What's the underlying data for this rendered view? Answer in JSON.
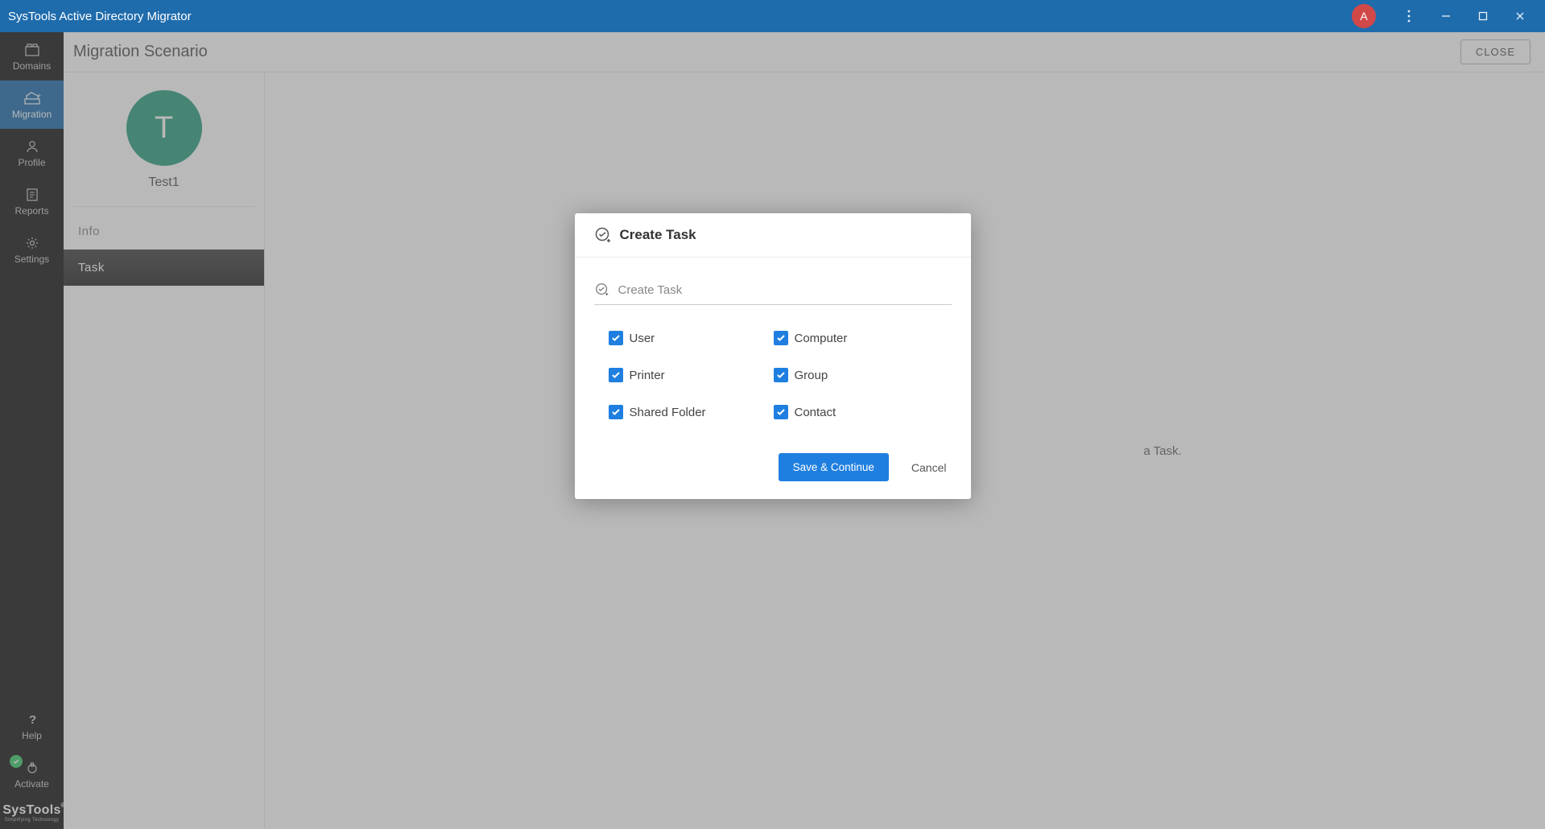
{
  "app": {
    "title": "SysTools Active Directory Migrator",
    "avatar_initial": "A"
  },
  "sidebar": {
    "items": [
      {
        "label": "Domains",
        "icon": "domains-icon"
      },
      {
        "label": "Migration",
        "icon": "migration-icon"
      },
      {
        "label": "Profile",
        "icon": "profile-icon"
      },
      {
        "label": "Reports",
        "icon": "reports-icon"
      },
      {
        "label": "Settings",
        "icon": "settings-icon"
      }
    ],
    "bottom": [
      {
        "label": "Help",
        "icon": "help-icon"
      },
      {
        "label": "Activate",
        "icon": "activate-icon"
      }
    ],
    "logo_main": "SysTools",
    "logo_sub": "Simplifying Technology"
  },
  "page": {
    "title": "Migration Scenario",
    "close_label": "CLOSE"
  },
  "scenario": {
    "avatar_initial": "T",
    "name": "Test1",
    "tabs": {
      "info": "Info",
      "task": "Task"
    },
    "background_hint": "a Task."
  },
  "modal": {
    "title": "Create Task",
    "input_placeholder": "Create Task",
    "options": {
      "user": "User",
      "computer": "Computer",
      "printer": "Printer",
      "group": "Group",
      "shared_folder": "Shared Folder",
      "contact": "Contact"
    },
    "save_label": "Save & Continue",
    "cancel_label": "Cancel"
  }
}
